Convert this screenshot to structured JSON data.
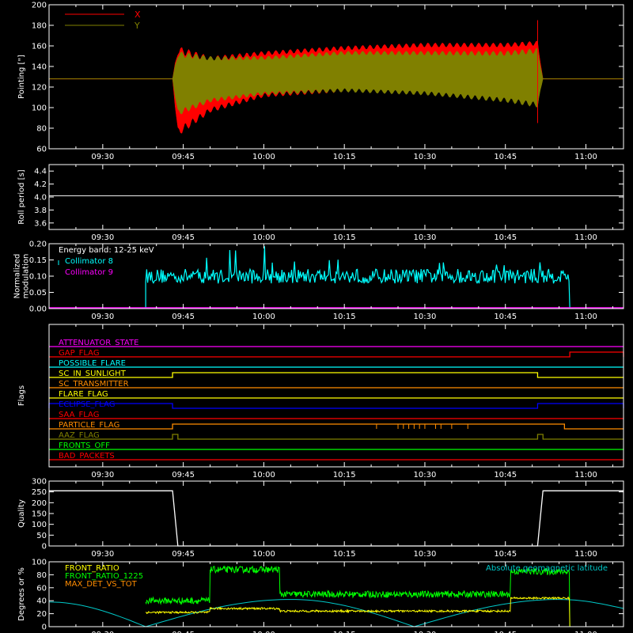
{
  "time_ticks": [
    "09:30",
    "09:45",
    "10:00",
    "10:15",
    "10:30",
    "10:45",
    "11:00"
  ],
  "colors": {
    "background": "#000000",
    "axes": "#ffffff",
    "x_series": "#ff0000",
    "y_series": "#808000",
    "roll": "#ffffff",
    "collimator8": "#00ffff",
    "collimator9": "#ff00ff",
    "front_ratio": "#ffff00",
    "front_ratio_1225": "#00ff00",
    "max_det": "#ff8c00",
    "latitude": "#00c8c8"
  },
  "chart_data": [
    {
      "name": "pointing",
      "type": "line",
      "ylabel": "Pointing [\"]",
      "ylim": [
        60,
        200
      ],
      "yticks": [
        60,
        80,
        100,
        120,
        140,
        160,
        180,
        200
      ],
      "x_range": [
        "09:20",
        "11:07"
      ],
      "legend": "top-left",
      "series": [
        {
          "name": "X",
          "color": "#ff0000",
          "envelope": [
            {
              "t": "09:20",
              "lo": 128,
              "hi": 128
            },
            {
              "t": "09:43",
              "lo": 128,
              "hi": 128
            },
            {
              "t": "09:44",
              "lo": 72,
              "hi": 160
            },
            {
              "t": "09:50",
              "lo": 95,
              "hi": 150
            },
            {
              "t": "10:00",
              "lo": 110,
              "hi": 155
            },
            {
              "t": "10:15",
              "lo": 115,
              "hi": 160
            },
            {
              "t": "10:30",
              "lo": 117,
              "hi": 163
            },
            {
              "t": "10:45",
              "lo": 117,
              "hi": 163
            },
            {
              "t": "10:51",
              "lo": 115,
              "hi": 165
            },
            {
              "t": "10:52",
              "lo": 128,
              "hi": 128
            },
            {
              "t": "11:07",
              "lo": 128,
              "hi": 128
            }
          ]
        },
        {
          "name": "Y",
          "color": "#808000",
          "envelope": [
            {
              "t": "09:20",
              "lo": 128,
              "hi": 128
            },
            {
              "t": "09:43",
              "lo": 128,
              "hi": 128
            },
            {
              "t": "09:44",
              "lo": 92,
              "hi": 155
            },
            {
              "t": "09:50",
              "lo": 105,
              "hi": 150
            },
            {
              "t": "10:00",
              "lo": 112,
              "hi": 150
            },
            {
              "t": "10:15",
              "lo": 115,
              "hi": 155
            },
            {
              "t": "10:30",
              "lo": 112,
              "hi": 155
            },
            {
              "t": "10:45",
              "lo": 105,
              "hi": 155
            },
            {
              "t": "10:51",
              "lo": 100,
              "hi": 158
            },
            {
              "t": "10:52",
              "lo": 128,
              "hi": 128
            },
            {
              "t": "11:07",
              "lo": 128,
              "hi": 128
            }
          ]
        }
      ]
    },
    {
      "name": "roll",
      "type": "line",
      "ylabel": "Roll period [s]",
      "ylim": [
        3.5,
        4.5
      ],
      "yticks": [
        3.6,
        3.8,
        4.0,
        4.2,
        4.4
      ],
      "series": [
        {
          "name": "",
          "points": [
            {
              "t": "09:20",
              "v": 4.02
            },
            {
              "t": "11:07",
              "v": 4.02
            }
          ]
        }
      ]
    },
    {
      "name": "modulation",
      "type": "bar",
      "ylabel": "Normalized\nmodulation",
      "ylim": [
        0,
        0.2
      ],
      "yticks": [
        "0.00",
        "0.05",
        "0.10",
        "0.15",
        "0.20"
      ],
      "annotation": "Energy band: 12-25 keV",
      "legend": "top-left",
      "series": [
        {
          "name": "Collimator 8",
          "color": "#00ffff",
          "start": "09:38",
          "end": "10:57",
          "mean": 0.1,
          "spread": 0.03
        },
        {
          "name": "Collimator 9",
          "color": "#ff00ff",
          "level": 0.0
        }
      ]
    },
    {
      "name": "flags",
      "type": "line",
      "ylabel": "Flags",
      "rows": [
        {
          "label": "ATTENUATOR_STATE",
          "color": "#ff00ff",
          "high": []
        },
        {
          "label": "GAP_FLAG",
          "color": "#ff0000",
          "high": [
            [
              "10:57",
              "11:07"
            ]
          ]
        },
        {
          "label": "POSSIBLE_FLARE",
          "color": "#00ffff",
          "high": []
        },
        {
          "label": "SC_IN_SUNLIGHT",
          "color": "#ffff00",
          "high": [
            [
              "09:43",
              "10:51"
            ]
          ]
        },
        {
          "label": "SC_TRANSMITTER",
          "color": "#ff8c00",
          "high": []
        },
        {
          "label": "FLARE_FLAG",
          "color": "#ffff00",
          "high": []
        },
        {
          "label": "ECLIPSE_FLAG",
          "color": "#0000ff",
          "high": [
            [
              "09:20",
              "09:43"
            ],
            [
              "10:51",
              "11:07"
            ]
          ]
        },
        {
          "label": "SAA_FLAG",
          "color": "#ff0000",
          "high": []
        },
        {
          "label": "PARTICLE_FLAG",
          "color": "#ff8c00",
          "high": [
            [
              "09:43",
              "10:56"
            ]
          ]
        },
        {
          "label": "AAZ_FLAG",
          "color": "#808000",
          "high": [
            [
              "09:43",
              "09:44"
            ],
            [
              "10:51",
              "10:52"
            ]
          ]
        },
        {
          "label": "FRONTS_OFF",
          "color": "#00ff00",
          "high": []
        },
        {
          "label": "BAD_PACKETS",
          "color": "#ff0000",
          "high": []
        }
      ]
    },
    {
      "name": "quality",
      "type": "line",
      "ylabel": "Quality",
      "ylim": [
        0,
        300
      ],
      "yticks": [
        0,
        50,
        100,
        150,
        200,
        250,
        300
      ],
      "series": [
        {
          "name": "",
          "points": [
            {
              "t": "09:20",
              "v": 255
            },
            {
              "t": "09:43",
              "v": 255
            },
            {
              "t": "09:44",
              "v": 0
            },
            {
              "t": "10:51",
              "v": 0
            },
            {
              "t": "10:52",
              "v": 255
            },
            {
              "t": "11:07",
              "v": 255
            }
          ]
        }
      ]
    },
    {
      "name": "ratios",
      "type": "line",
      "ylabel": "Degrees or %",
      "ylim": [
        0,
        100
      ],
      "yticks": [
        0,
        20,
        40,
        60,
        80,
        100
      ],
      "legend": "top-left",
      "legend_right": "Absolute geomagnetic latitude",
      "series": [
        {
          "name": "FRONT_RATIO",
          "color": "#ffff00",
          "steps": [
            {
              "t0": "09:38",
              "t1": "09:50",
              "v": 22
            },
            {
              "t0": "09:50",
              "t1": "10:03",
              "v": 28
            },
            {
              "t0": "10:03",
              "t1": "10:46",
              "v": 24
            },
            {
              "t0": "10:46",
              "t1": "10:57",
              "v": 44
            }
          ]
        },
        {
          "name": "FRONT_RATIO_1225",
          "color": "#00ff00",
          "steps": [
            {
              "t0": "09:38",
              "t1": "09:50",
              "v": 40
            },
            {
              "t0": "09:50",
              "t1": "10:03",
              "v": 88
            },
            {
              "t0": "10:03",
              "t1": "10:46",
              "v": 50
            },
            {
              "t0": "10:46",
              "t1": "10:57",
              "v": 85
            }
          ]
        },
        {
          "name": "MAX_DET_VS_TOT",
          "color": "#ff8c00",
          "steps": []
        },
        {
          "name": "Absolute geomagnetic latitude",
          "color": "#00c8c8",
          "points": [
            {
              "t": "09:20",
              "v": 38
            },
            {
              "t": "09:38",
              "v": 0
            },
            {
              "t": "10:05",
              "v": 42
            },
            {
              "t": "10:28",
              "v": 0
            },
            {
              "t": "10:55",
              "v": 42
            },
            {
              "t": "11:07",
              "v": 28
            }
          ]
        }
      ]
    }
  ]
}
